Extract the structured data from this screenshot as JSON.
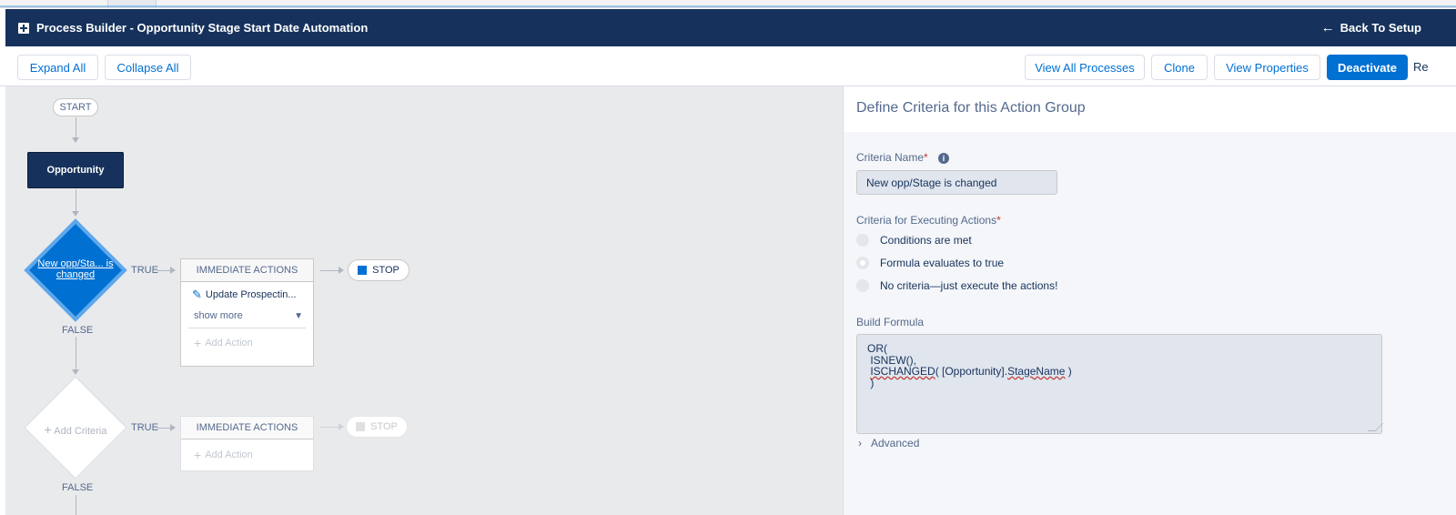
{
  "header": {
    "title": "Process Builder - Opportunity Stage Start Date Automation",
    "back_label": "Back To Setup"
  },
  "toolbar": {
    "expand_all": "Expand All",
    "collapse_all": "Collapse All",
    "view_all_processes": "View All Processes",
    "clone": "Clone",
    "view_properties": "View Properties",
    "deactivate": "Deactivate",
    "cut_text": "Re"
  },
  "canvas": {
    "start_label": "START",
    "object_node": "Opportunity",
    "criteria_1": {
      "label": "New opp/Sta... is changed",
      "true_label": "TRUE",
      "false_label": "FALSE"
    },
    "criteria_2": {
      "label": "Add Criteria",
      "true_label": "TRUE",
      "false_label": "FALSE"
    },
    "actions_1": {
      "header": "IMMEDIATE ACTIONS",
      "item": "Update Prospectin...",
      "show_more": "show more",
      "add_action": "Add Action"
    },
    "actions_2": {
      "header": "IMMEDIATE ACTIONS",
      "add_action": "Add Action"
    },
    "stop_label": "STOP"
  },
  "panel": {
    "title": "Define Criteria for this Action Group",
    "criteria_name_label": "Criteria Name",
    "criteria_name_value": "New opp/Stage is changed",
    "execute_label": "Criteria for Executing Actions",
    "options": [
      "Conditions are met",
      "Formula evaluates to true",
      "No criteria—just execute the actions!"
    ],
    "selected_option": "Formula evaluates to true",
    "build_formula_label": "Build Formula",
    "formula": {
      "line1": "OR(",
      "line2": " ISNEW(),",
      "line3_fn": "ISCHANGED",
      "line3_mid": "( [Opportunity].",
      "line3_field": "StageName",
      "line3_end": " )",
      "line4": " )"
    },
    "advanced_label": "Advanced"
  }
}
